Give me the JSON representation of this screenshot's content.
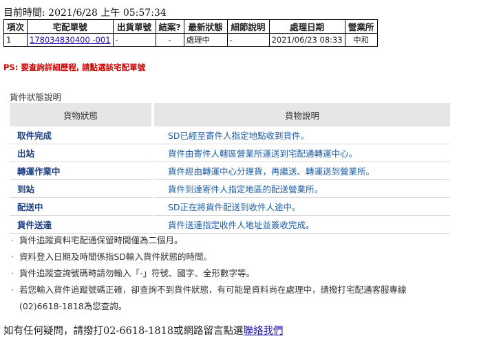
{
  "current_time": "目前時間: 2021/6/28 上午 05:57:34",
  "tracking_table": {
    "headers": [
      "項次",
      "宅配單號",
      "出貨單號",
      "結案?",
      "最新狀態",
      "細節說明",
      "處理日期",
      "營業所"
    ],
    "rows": [
      {
        "index": "1",
        "tracking_no": "178034830400 -001",
        "shipment_no": "-",
        "closed": "-",
        "status": "處理中",
        "detail": "-",
        "date": "2021/06/23 08:33",
        "office": "中和"
      }
    ]
  },
  "ps_note": "PS: 要查詢詳細歷程, 請點選該宅配單號",
  "legend": {
    "title": "貨件狀態說明",
    "col_status": "貨物狀態",
    "col_desc": "貨物說明",
    "rows": [
      {
        "name": "取件完成",
        "desc": "SD已經至寄件人指定地點收到貨件。"
      },
      {
        "name": "出站",
        "desc": "貨件由寄件人轄區營業所運送到宅配通轉運中心。"
      },
      {
        "name": "轉運作業中",
        "desc": "貨件經由轉運中心分理貨，再繼送、轉運送到營業所。"
      },
      {
        "name": "到站",
        "desc": "貨件到達寄件人指定地區的配送營業所。"
      },
      {
        "name": "配送中",
        "desc": "SD正在將貨件配送到收件人途中。"
      },
      {
        "name": "貨件送達",
        "desc": "貨件送達指定收件人地址並簽收完成。"
      }
    ]
  },
  "notes": [
    "貨件追蹤資料宅配通保留時間僅為二個月。",
    "資料登入日期及時間係指SD輸入貨件狀態的時間。",
    "貨件追蹤查詢號碼時請勿輸入「-」符號、國字、全形數字等。",
    "若您輸入貨件追蹤號碼正確，卻查詢不到貨件狀態，有可能是資料尚在處理中，請撥打宅配通客服專線",
    "(02)6618-1818為您查詢。"
  ],
  "bullet": "·",
  "contact": {
    "text": "如有任何疑問，請撥打02-6618-1818或網路留言點選",
    "link": "聯絡我們"
  },
  "colors": {
    "ps": "#cc0000",
    "legend_name": "#1b3f85",
    "legend_desc": "#1b5ea8",
    "header_bg": "#e6e6e6",
    "link": "#1a0dab"
  }
}
